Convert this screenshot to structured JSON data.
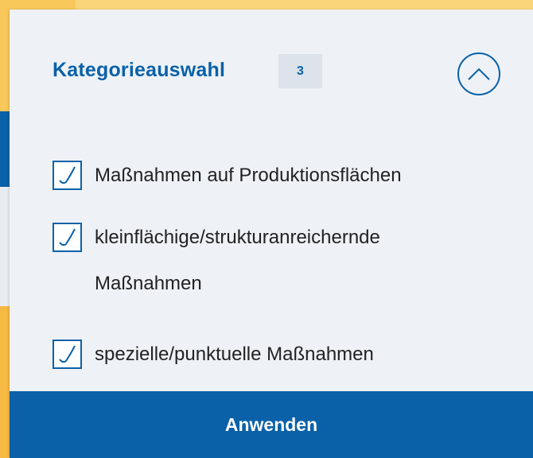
{
  "filter_panel": {
    "title": "Kategorieauswahl",
    "selected_count": "3",
    "collapse_icon": "chevron-up-icon"
  },
  "options": [
    {
      "label": "Maßnahmen auf Produktionsflächen",
      "checked": true
    },
    {
      "label": "kleinflächige/strukturanreichernde Maßnahmen",
      "checked": true
    },
    {
      "label": "spezielle/punktuelle Maßnahmen",
      "checked": true
    }
  ],
  "apply_button": {
    "label": "Anwenden"
  },
  "colors": {
    "accent": "#0a61a8",
    "panel_bg": "#eef2f6",
    "page_bg": "#f9c85a"
  }
}
